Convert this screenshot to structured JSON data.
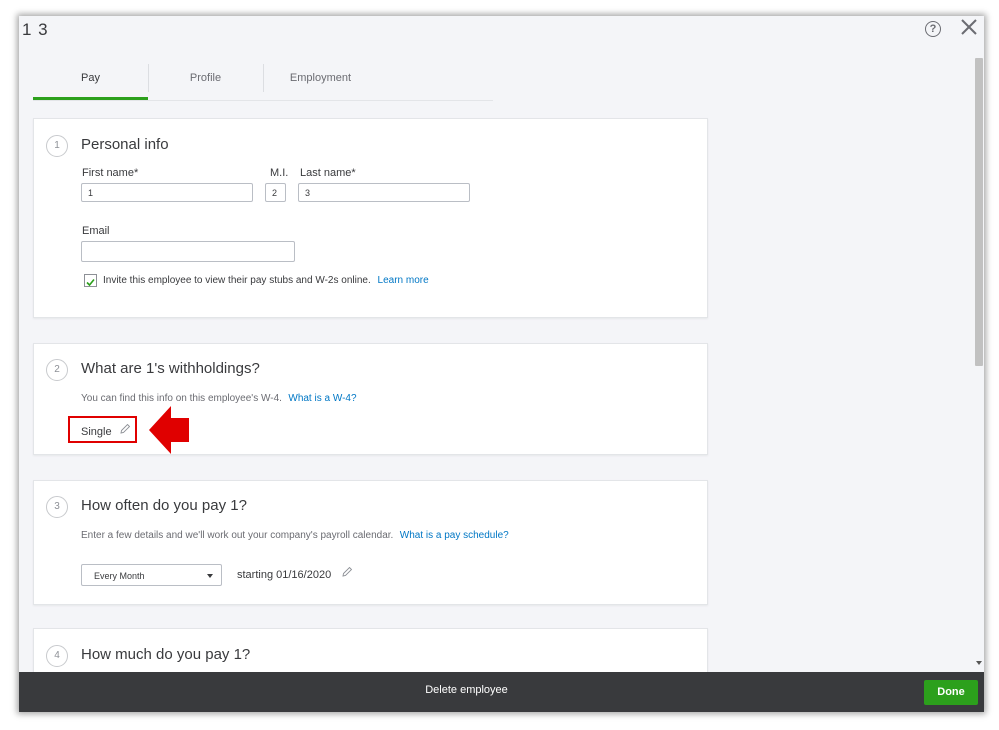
{
  "window": {
    "title": "1 3"
  },
  "tabs": [
    {
      "label": "Pay"
    },
    {
      "label": "Profile"
    },
    {
      "label": "Employment"
    }
  ],
  "section1": {
    "step": "1",
    "title": "Personal info",
    "first_name_label": "First name*",
    "first_name_value": "1",
    "mi_label": "M.I.",
    "mi_value": "2",
    "last_name_label": "Last name*",
    "last_name_value": "3",
    "email_label": "Email",
    "email_value": "",
    "invite_checked": true,
    "invite_text": "Invite this employee to view their pay stubs and W-2s online.",
    "learn_more": "Learn more"
  },
  "section2": {
    "step": "2",
    "title": "What are 1's withholdings?",
    "description": "You can find this info on this employee's W-4.",
    "link": "What is a W-4?",
    "filing_status": "Single"
  },
  "section3": {
    "step": "3",
    "title": "How often do you pay 1?",
    "description": "Enter a few details and we'll work out your company's payroll calendar.",
    "link": "What is a pay schedule?",
    "frequency": "Every Month",
    "starting": "starting 01/16/2020"
  },
  "section4": {
    "step": "4",
    "title": "How much do you pay 1?"
  },
  "footer": {
    "delete_label": "Delete employee",
    "done_label": "Done"
  },
  "colors": {
    "accent": "#2ca01c",
    "link": "#0077c5",
    "annotation": "#e00000",
    "footer_bg": "#393a3d"
  }
}
